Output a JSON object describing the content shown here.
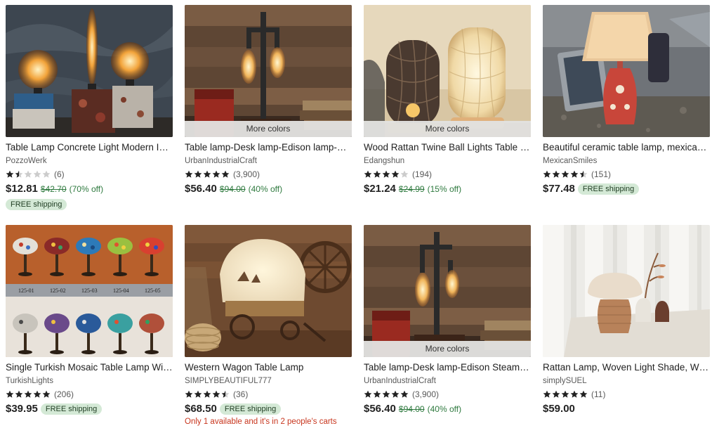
{
  "listings": [
    {
      "title": "Table Lamp Concrete Light Modern Industrial Lamp",
      "shop": "PozzoWerk",
      "rating": 1.5,
      "reviews": "(6)",
      "price": "$12.81",
      "original_price": "$42.70",
      "discount": "(70% off)",
      "free_shipping": "FREE shipping",
      "image": "edison-bulbs-concrete-lamp"
    },
    {
      "title": "Table lamp-Desk lamp-Edison lamp-Steampunk Lamp",
      "shop": "UrbanIndustrialCraft",
      "rating": 5,
      "reviews": "(3,900)",
      "price": "$56.40",
      "original_price": "$94.00",
      "discount": "(40% off)",
      "more_colors": "More colors",
      "image": "pipe-lamp-edison"
    },
    {
      "title": "Wood Rattan Twine Ball Lights Table Lamp",
      "shop": "Edangshun",
      "rating": 4,
      "reviews": "(194)",
      "price": "$21.24",
      "original_price": "$24.99",
      "discount": "(15% off)",
      "more_colors": "More colors",
      "image": "rattan-twine-lamps"
    },
    {
      "title": "Beautiful ceramic table lamp, mexican talavera",
      "shop": "MexicanSmiles",
      "rating": 4.5,
      "reviews": "(151)",
      "price": "$77.48",
      "free_shipping": "FREE shipping",
      "image": "ceramic-talavera-lamp"
    },
    {
      "title": "Single Turkish Mosaic Table Lamp With Bronze Base",
      "shop": "TurkishLights",
      "rating": 5,
      "reviews": "(206)",
      "price": "$39.95",
      "free_shipping": "FREE shipping",
      "image": "turkish-mosaic-lamps",
      "image_labels": [
        "125-01",
        "125-02",
        "125-03",
        "125-04",
        "125-05"
      ]
    },
    {
      "title": "Western Wagon Table Lamp",
      "shop": "SIMPLYBEAUTIFUL777",
      "rating": 4.5,
      "reviews": "(36)",
      "price": "$68.50",
      "free_shipping": "FREE shipping",
      "warning": "Only 1 available and it's in 2 people's carts",
      "image": "wagon-lamp"
    },
    {
      "title": "Table lamp-Desk lamp-Edison Steampunk Lamp",
      "shop": "UrbanIndustrialCraft",
      "rating": 5,
      "reviews": "(3,900)",
      "price": "$56.40",
      "original_price": "$94.00",
      "discount": "(40% off)",
      "more_colors": "More colors",
      "image": "pipe-lamp-edison"
    },
    {
      "title": "Rattan Lamp, Woven Light Shade, Wicker Lamp",
      "shop": "simplySUEL",
      "rating": 5,
      "reviews": "(11)",
      "price": "$59.00",
      "image": "rattan-mushroom-lamp"
    }
  ],
  "colors": {
    "star": "#222222",
    "star_empty": "#cccccc",
    "discount": "#2f7a3f",
    "badge_bg": "#d4e9d6",
    "warning": "#c8361e"
  }
}
